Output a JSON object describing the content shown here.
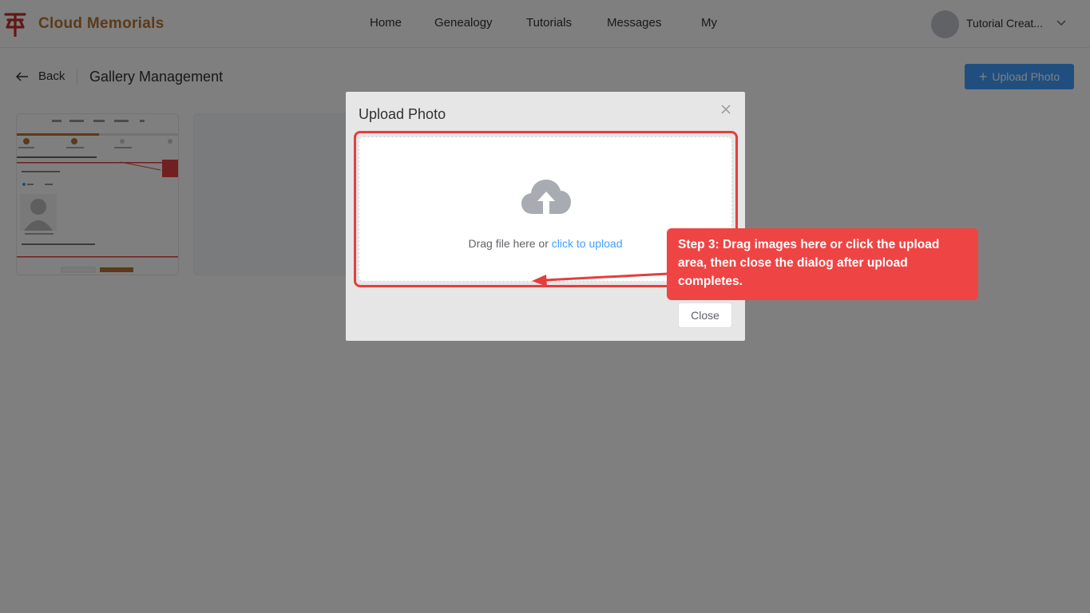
{
  "header": {
    "brand": "Cloud Memorials",
    "nav": [
      "Home",
      "Genealogy",
      "Tutorials",
      "Messages",
      "My"
    ],
    "user_name": "Tutorial Creat...",
    "brand_color": "#b8752f",
    "logo_color": "#c0322b"
  },
  "subheader": {
    "back_label": "Back",
    "title": "Gallery Management",
    "upload_label": "Upload Photo"
  },
  "dialog": {
    "title": "Upload Photo",
    "drop_text": "Drag file here or ",
    "drop_link": "click to upload",
    "close_label": "Close"
  },
  "annotation": {
    "text": "Step 3: Drag images here or click the upload area, then close the dialog after upload completes.",
    "color": "#ef4444"
  },
  "colors": {
    "primary": "#409eff"
  }
}
